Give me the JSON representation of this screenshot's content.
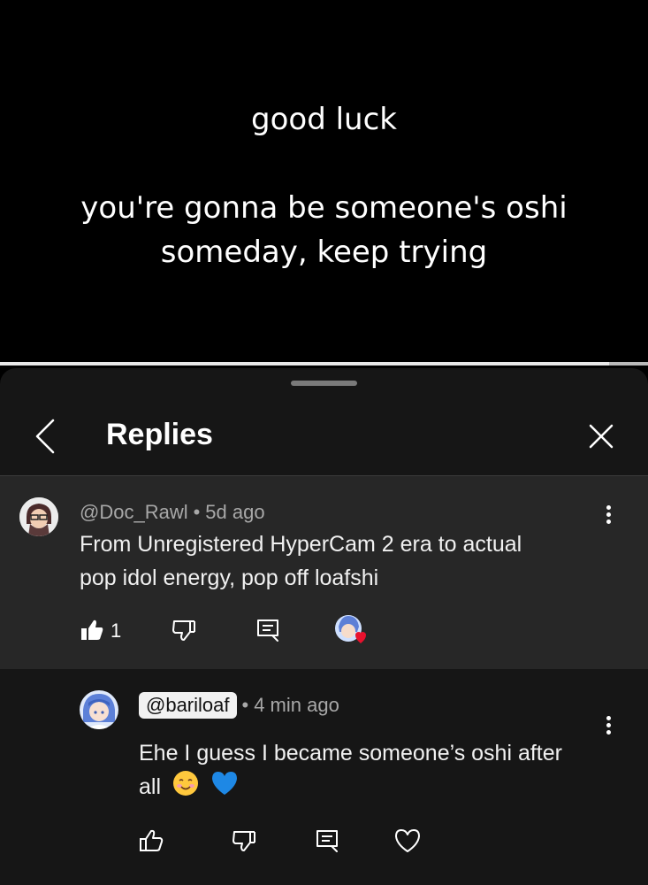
{
  "video": {
    "caption_line1": "good luck",
    "caption_line2": "you're gonna be someone's oshi",
    "caption_line3": "someday, keep trying",
    "progress_fraction": 0.94
  },
  "sheet": {
    "title": "Replies",
    "back_icon": "chevron-left-icon",
    "close_icon": "close-icon"
  },
  "parent_comment": {
    "author": "@Doc_Rawl",
    "separator": "•",
    "time": "5d ago",
    "text_line1": "From Unregistered HyperCam 2 era to actual",
    "text_line2": "pop idol energy, pop off loafshi",
    "like_count": "1",
    "liked": true,
    "creator_heart": true
  },
  "reply_comment": {
    "author": "@bariloaf",
    "separator": "•",
    "time": "4 min ago",
    "text_line1": "Ehe I guess I became someone’s oshi after",
    "text_line2": "all",
    "emoji1": "smiling-face-icon",
    "emoji2": "blue-heart-icon"
  },
  "colors": {
    "sheet_bg": "#161616",
    "parent_bg": "#272727",
    "meta_text": "#a8a8a8",
    "heart_red": "#e8112d",
    "blue_heart": "#1e88e5"
  }
}
